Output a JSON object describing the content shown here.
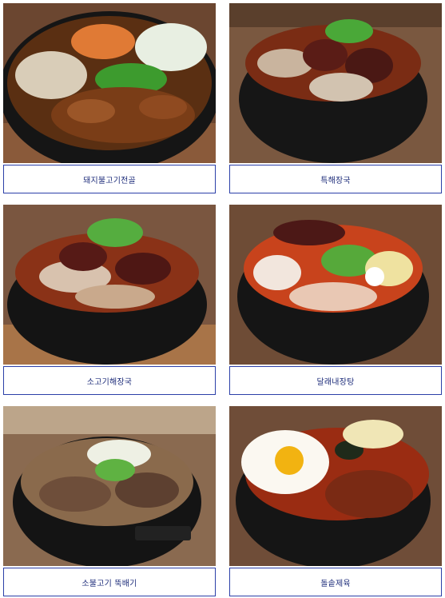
{
  "menu": {
    "items": [
      {
        "id": "1",
        "name": "돼지불고기전골",
        "image_icon": "pork-bulgogi-hotpot-photo"
      },
      {
        "id": "2",
        "name": "특해장국",
        "image_icon": "special-haejangguk-photo"
      },
      {
        "id": "3",
        "name": "소고기해장국",
        "image_icon": "beef-haejangguk-photo"
      },
      {
        "id": "4",
        "name": "달래내장탕",
        "image_icon": "dallae-naejangtang-photo"
      },
      {
        "id": "5",
        "name": "소불고기 뚝배기",
        "image_icon": "beef-bulgogi-ttukbaegi-photo"
      },
      {
        "id": "6",
        "name": "돌솥제육",
        "image_icon": "stone-pot-jeyuk-photo"
      }
    ]
  },
  "colors": {
    "caption_border": "#2b3fa8",
    "caption_text": "#1d2c7a",
    "background": "#ffffff"
  }
}
